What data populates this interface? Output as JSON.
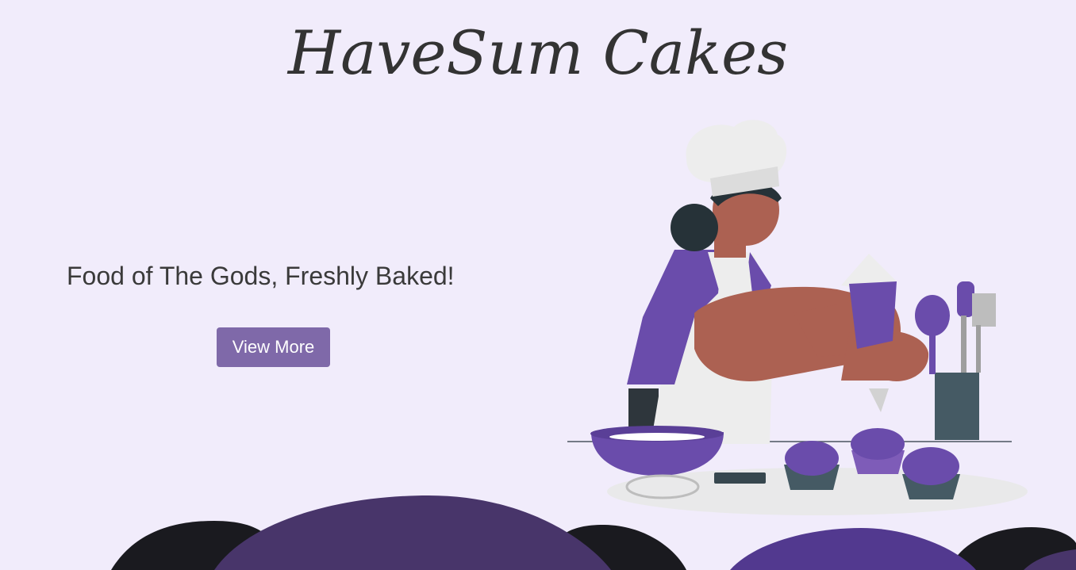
{
  "header": {
    "title": "HaveSum Cakes"
  },
  "hero": {
    "tagline": "Food of The Gods, Freshly Baked!",
    "cta_label": "View More"
  },
  "colors": {
    "background": "#f1ecfb",
    "accent": "#7f69a9",
    "purple": "#6a4cab",
    "dark_wave": "#1a1a1f",
    "mid_wave": "#48356a",
    "bright_wave": "#52398f"
  },
  "icons": {
    "illustration": "baker-decorating-cupcakes-illustration"
  }
}
